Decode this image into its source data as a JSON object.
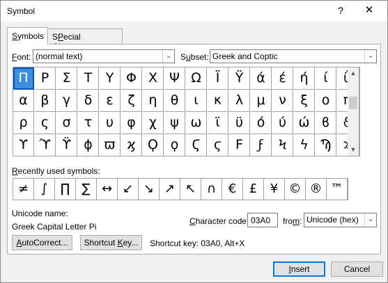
{
  "dialog": {
    "title": "Symbol",
    "help_label": "?",
    "close_label": "✕"
  },
  "tabs": [
    {
      "label_hotkey": "S",
      "label_rest": "ymbols"
    },
    {
      "label_hotkey": "P",
      "label_rest": "ecial Characters",
      "label_pre": "S"
    }
  ],
  "font": {
    "label_hotkey": "F",
    "label_rest": "ont:",
    "value": "(normal text)"
  },
  "subset": {
    "label_pre": "S",
    "label_hotkey": "u",
    "label_rest": "bset:",
    "value": "Greek and Coptic"
  },
  "grid": {
    "rows": [
      [
        "Π",
        "Ρ",
        "Σ",
        "Τ",
        "Υ",
        "Φ",
        "Χ",
        "Ψ",
        "Ω",
        "Ϊ",
        "Ϋ",
        "ά",
        "έ",
        "ή",
        "ί",
        "ΰ"
      ],
      [
        "α",
        "β",
        "γ",
        "δ",
        "ε",
        "ζ",
        "η",
        "θ",
        "ι",
        "κ",
        "λ",
        "μ",
        "ν",
        "ξ",
        "ο",
        "π"
      ],
      [
        "ρ",
        "ς",
        "σ",
        "τ",
        "υ",
        "φ",
        "χ",
        "ψ",
        "ω",
        "ϊ",
        "ϋ",
        "ό",
        "ύ",
        "ώ",
        "ϐ",
        "ϑ"
      ],
      [
        "ϒ",
        "ϓ",
        "ϔ",
        "ϕ",
        "ϖ",
        "ϗ",
        "Ϙ",
        "ϙ",
        "Ϛ",
        "ϛ",
        "Ϝ",
        "ϝ",
        "Ϟ",
        "ϟ",
        "Ϡ",
        "ϡ"
      ]
    ],
    "selected": [
      0,
      0
    ],
    "scroll_up": "▲",
    "scroll_down": "▼"
  },
  "recent": {
    "label_hotkey": "R",
    "label_rest": "ecently used symbols:",
    "symbols": [
      "≠",
      "∫",
      "∏",
      "∑",
      "↔",
      "↙",
      "↘",
      "↗",
      "↖",
      "∩",
      "€",
      "£",
      "¥",
      "©",
      "®",
      "™"
    ]
  },
  "unicode_name": {
    "label": "Unicode name:",
    "value": "Greek Capital Letter Pi"
  },
  "char_code": {
    "label_hotkey": "C",
    "label_rest": "haracter code:",
    "value": "03A0"
  },
  "from": {
    "label_pre": "fro",
    "label_hotkey": "m",
    "label_rest": ":",
    "value": "Unicode (hex)"
  },
  "buttons": {
    "autocorrect_hotkey": "A",
    "autocorrect_rest": "utoCorrect...",
    "shortcut_pre": "Shortcut ",
    "shortcut_hotkey": "K",
    "shortcut_rest": "ey...",
    "insert_hotkey": "I",
    "insert_rest": "nsert",
    "cancel": "Cancel"
  },
  "shortcut_info": "Shortcut key: 03A0, Alt+X",
  "dropdown_arrow": "⌄"
}
